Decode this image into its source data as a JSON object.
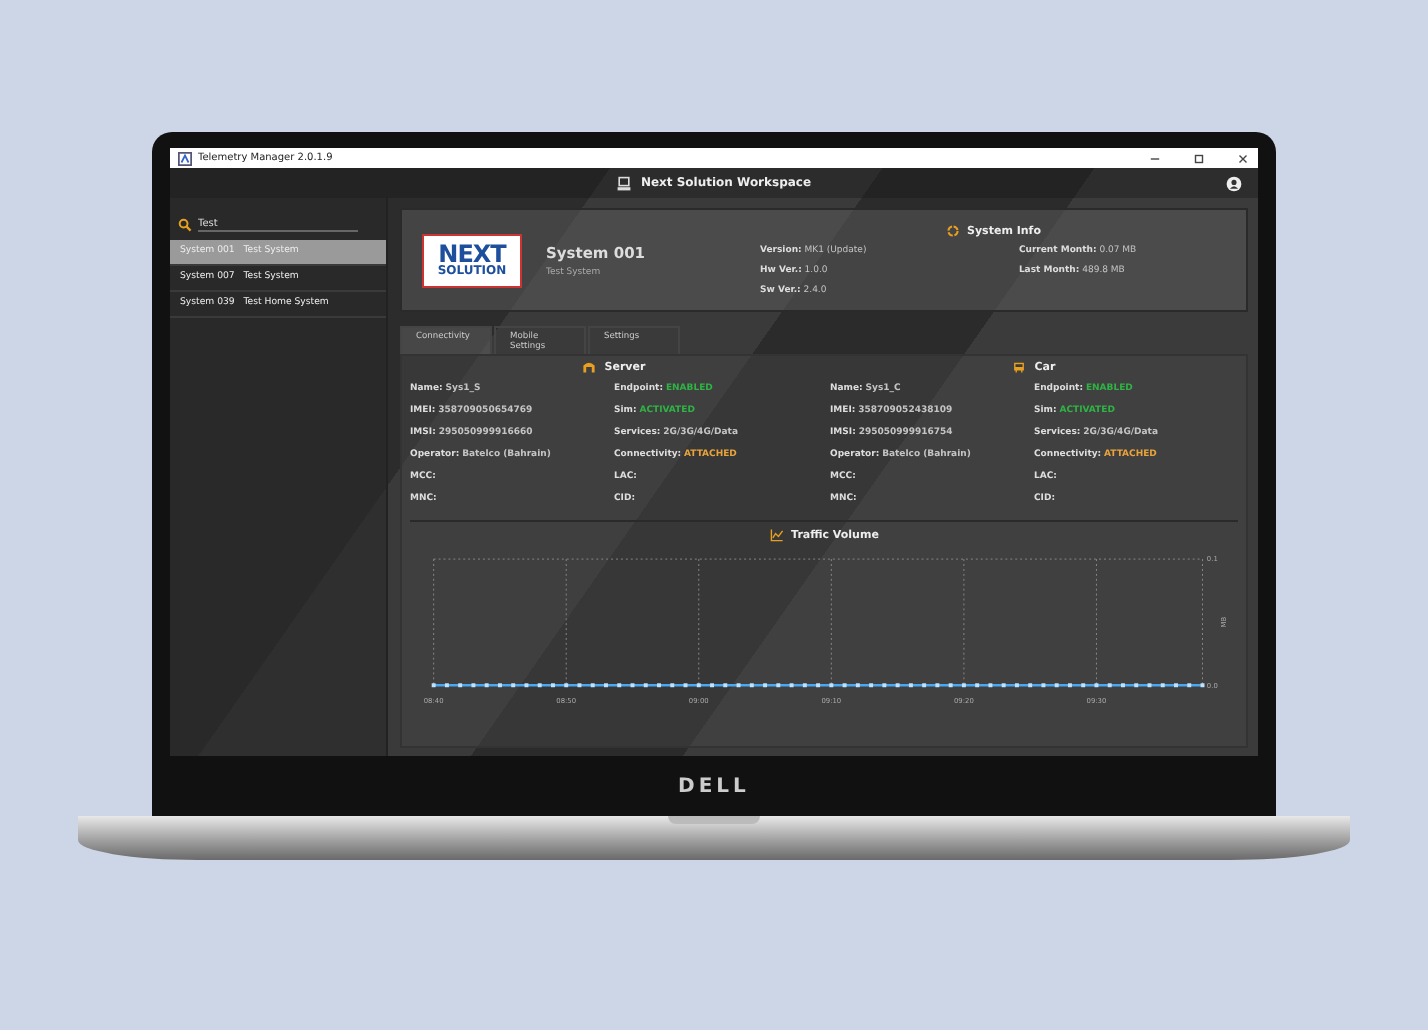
{
  "window": {
    "title": "Telemetry Manager 2.0.1.9"
  },
  "header": {
    "title": "Next Solution Workspace"
  },
  "search": {
    "value": "Test"
  },
  "systems": [
    {
      "id": "System 001",
      "name": "Test System",
      "selected": true
    },
    {
      "id": "System 007",
      "name": "Test System",
      "selected": false
    },
    {
      "id": "System 039",
      "name": "Test Home System",
      "selected": false
    }
  ],
  "logo": {
    "line1": "NEXT",
    "line2": "SOLUTION"
  },
  "system": {
    "name": "System 001",
    "description": "Test System"
  },
  "system_info": {
    "title": "System Info",
    "fields": [
      {
        "label": "Version:",
        "value": "MK1 (Update)"
      },
      {
        "label": "Current Month:",
        "value": "0.07 MB"
      },
      {
        "label": "Hw Ver.:",
        "value": "1.0.0"
      },
      {
        "label": "Last Month:",
        "value": "489.8 MB"
      },
      {
        "label": "Sw Ver.:",
        "value": "2.4.0"
      }
    ]
  },
  "tabs": [
    {
      "label": "Connectivity",
      "selected": true
    },
    {
      "label": "Mobile Settings",
      "selected": false
    },
    {
      "label": "Settings",
      "selected": false
    }
  ],
  "devices": [
    {
      "title": "Server",
      "kind": "server",
      "fields": [
        {
          "label": "Name:",
          "value": "Sys1_S"
        },
        {
          "label": "Endpoint:",
          "value": "ENABLED",
          "color": "#2fb344"
        },
        {
          "label": "IMEI:",
          "value": "358709050654769"
        },
        {
          "label": "Sim:",
          "value": "ACTIVATED",
          "color": "#2fb344"
        },
        {
          "label": "IMSI:",
          "value": "295050999916660"
        },
        {
          "label": "Services:",
          "value": "2G/3G/4G/Data"
        },
        {
          "label": "Operator:",
          "value": "Batelco (Bahrain)"
        },
        {
          "label": "Connectivity:",
          "value": "ATTACHED",
          "color": "#e8a33a"
        },
        {
          "label": "MCC:"
        },
        {
          "label": "LAC:"
        },
        {
          "label": "MNC:"
        },
        {
          "label": "CID:"
        }
      ]
    },
    {
      "title": "Car",
      "kind": "car",
      "fields": [
        {
          "label": "Name:",
          "value": "Sys1_C"
        },
        {
          "label": "Endpoint:",
          "value": "ENABLED",
          "color": "#2fb344"
        },
        {
          "label": "IMEI:",
          "value": "358709052438109"
        },
        {
          "label": "Sim:",
          "value": "ACTIVATED",
          "color": "#2fb344"
        },
        {
          "label": "IMSI:",
          "value": "295050999916754"
        },
        {
          "label": "Services:",
          "value": "2G/3G/4G/Data"
        },
        {
          "label": "Operator:",
          "value": "Batelco (Bahrain)"
        },
        {
          "label": "Connectivity:",
          "value": "ATTACHED",
          "color": "#e8a33a"
        },
        {
          "label": "MCC:"
        },
        {
          "label": "LAC:"
        },
        {
          "label": "MNC:"
        },
        {
          "label": "CID:"
        }
      ]
    }
  ],
  "traffic": {
    "title": "Traffic Volume",
    "chart_data": {
      "type": "line",
      "ylabel": "MB",
      "categories": [
        "08:40",
        null,
        null,
        null,
        null,
        null,
        null,
        null,
        null,
        null,
        "08:50",
        null,
        null,
        null,
        null,
        null,
        null,
        null,
        null,
        null,
        "09:00",
        null,
        null,
        null,
        null,
        null,
        null,
        null,
        null,
        null,
        "09:10",
        null,
        null,
        null,
        null,
        null,
        null,
        null,
        null,
        null,
        "09:20",
        null,
        null,
        null,
        null,
        null,
        null,
        null,
        null,
        null,
        "09:30",
        null,
        null,
        null,
        null,
        null,
        null,
        null,
        null
      ],
      "grid": true,
      "series": [
        {
          "color": "#4aa8f0",
          "marker": true,
          "values": [
            0,
            0,
            0,
            0,
            0,
            0,
            0,
            0,
            0,
            0,
            0,
            0,
            0,
            0,
            0,
            0,
            0,
            0,
            0,
            0,
            0,
            0,
            0,
            0,
            0,
            0,
            0,
            0,
            0,
            0,
            0,
            0,
            0,
            0,
            0,
            0,
            0,
            0,
            0,
            0,
            0,
            0,
            0,
            0,
            0,
            0,
            0,
            0,
            0,
            0,
            0,
            0,
            0,
            0,
            0,
            0,
            0,
            0,
            0
          ]
        }
      ],
      "ylim": [
        0,
        0.1
      ],
      "yticks": [
        {
          "value": 0,
          "label": "0.0"
        },
        0.1
      ]
    }
  },
  "bezel_logo": "DELL"
}
